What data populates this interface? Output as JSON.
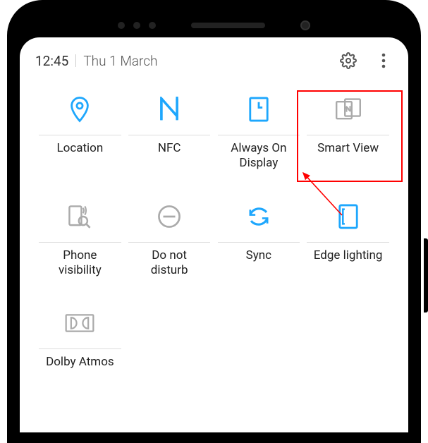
{
  "status": {
    "time": "12:45",
    "date": "Thu 1 March"
  },
  "icons": {
    "settings": "gear-icon",
    "more": "more-icon"
  },
  "tiles": [
    {
      "id": "location",
      "label": "Location",
      "active": true
    },
    {
      "id": "nfc",
      "label": "NFC",
      "active": true
    },
    {
      "id": "aod",
      "label": "Always On\nDisplay",
      "active": true
    },
    {
      "id": "smartview",
      "label": "Smart View",
      "active": false,
      "highlighted": true
    },
    {
      "id": "phonevis",
      "label": "Phone\nvisibility",
      "active": false
    },
    {
      "id": "dnd",
      "label": "Do not\ndisturb",
      "active": false
    },
    {
      "id": "sync",
      "label": "Sync",
      "active": true
    },
    {
      "id": "edgelight",
      "label": "Edge lighting",
      "active": true
    },
    {
      "id": "dolby",
      "label": "Dolby Atmos",
      "active": false
    }
  ],
  "highlight": {
    "target": "smartview"
  }
}
